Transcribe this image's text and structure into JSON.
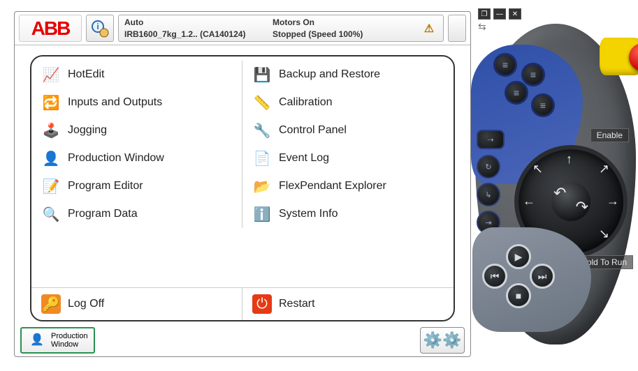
{
  "header": {
    "logo_text": "ABB",
    "mode": "Auto",
    "system": "IRB1600_7kg_1.2.. (CA140124)",
    "motors": "Motors On",
    "state": "Stopped (Speed 100%)"
  },
  "menu": {
    "left": [
      {
        "label": "HotEdit",
        "icon": "📈"
      },
      {
        "label": "Inputs and Outputs",
        "icon": "🔁"
      },
      {
        "label": "Jogging",
        "icon": "🕹️"
      },
      {
        "label": "Production Window",
        "icon": "👤"
      },
      {
        "label": "Program Editor",
        "icon": "📝"
      },
      {
        "label": "Program Data",
        "icon": "🔍"
      }
    ],
    "right": [
      {
        "label": "Backup and Restore",
        "icon": "💾"
      },
      {
        "label": "Calibration",
        "icon": "📏"
      },
      {
        "label": "Control Panel",
        "icon": "🔧"
      },
      {
        "label": "Event Log",
        "icon": "📄"
      },
      {
        "label": "FlexPendant Explorer",
        "icon": "📂"
      },
      {
        "label": "System Info",
        "icon": "ℹ️"
      }
    ],
    "logoff": "Log Off",
    "restart": "Restart"
  },
  "taskbar": {
    "task1_line1": "Production",
    "task1_line2": "Window"
  },
  "pendant": {
    "enable": "Enable",
    "hold": "Hold To Run"
  }
}
